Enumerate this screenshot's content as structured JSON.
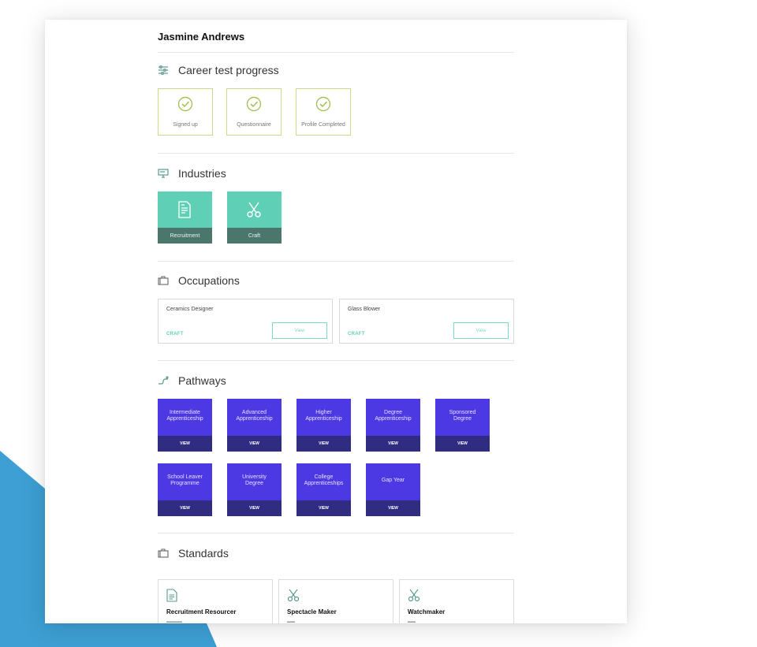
{
  "colors": {
    "progress_border": "#c9d98c",
    "check": "#a6c35a",
    "industry_tile": "#5fcfb5",
    "industry_label_bg": "#4a766c",
    "pathway_tile": "#4c39e3",
    "pathway_button": "#2f2c82",
    "background_accent": "#3d9fd3"
  },
  "user": {
    "name": "Jasmine Andrews"
  },
  "progress": {
    "title": "Career test progress",
    "icon": "sliders-icon",
    "steps": [
      {
        "label": "Signed up",
        "icon": "check-circle-icon"
      },
      {
        "label": "Questionnaire",
        "icon": "check-circle-icon"
      },
      {
        "label": "Profile Completed",
        "icon": "check-circle-icon"
      }
    ]
  },
  "industries": {
    "title": "Industries",
    "icon": "monitor-icon",
    "items": [
      {
        "label": "Recruitment",
        "icon": "document-icon"
      },
      {
        "label": "Craft",
        "icon": "scissors-icon"
      }
    ]
  },
  "occupations": {
    "title": "Occupations",
    "icon": "briefcase-icon",
    "items": [
      {
        "title": "Ceramics Designer",
        "category": "CRAFT",
        "button": "View"
      },
      {
        "title": "Glass Blower",
        "category": "CRAFT",
        "button": "View"
      }
    ]
  },
  "pathways": {
    "title": "Pathways",
    "icon": "route-icon",
    "items": [
      {
        "line1": "Intermediate",
        "line2": "Apprenticeship",
        "button": "VIEW"
      },
      {
        "line1": "Advanced",
        "line2": "Apprenticeship",
        "button": "VIEW"
      },
      {
        "line1": "Higher",
        "line2": "Apprenticeship",
        "button": "VIEW"
      },
      {
        "line1": "Degree",
        "line2": "Apprenticeship",
        "button": "VIEW"
      },
      {
        "line1": "Sponsored",
        "line2": "Degree",
        "button": "VIEW"
      },
      {
        "line1": "School Leaver",
        "line2": "Programme",
        "button": "VIEW"
      },
      {
        "line1": "University",
        "line2": "Degree",
        "button": "VIEW"
      },
      {
        "line1": "College",
        "line2": "Apprenticeships",
        "button": "VIEW"
      },
      {
        "line1": "Gap Year",
        "line2": "",
        "button": "VIEW"
      }
    ]
  },
  "standards": {
    "title": "Standards",
    "icon": "briefcase-icon",
    "items": [
      {
        "title": "Recruitment Resourcer",
        "icon": "document-icon"
      },
      {
        "title": "Spectacle Maker",
        "icon": "scissors-icon"
      },
      {
        "title": "Watchmaker",
        "icon": "scissors-icon"
      }
    ]
  }
}
